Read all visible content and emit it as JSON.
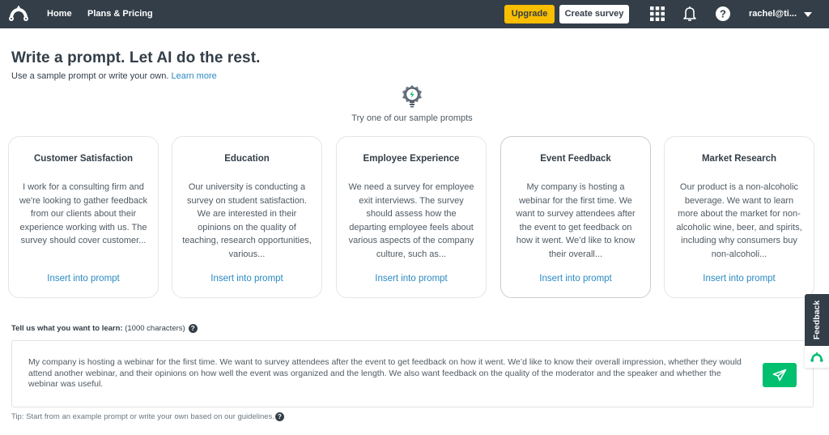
{
  "topbar": {
    "logo_icon": "surveymonkey-logo-icon",
    "nav": [
      {
        "label": "Home"
      },
      {
        "label": "Plans & Pricing"
      }
    ],
    "upgrade_label": "Upgrade",
    "create_survey_label": "Create survey",
    "apps_icon": "apps-grid-icon",
    "notifications_icon": "bell-icon",
    "help_icon": "help-icon",
    "user_label": "rachel@ti...",
    "colors": {
      "bar": "#333e48",
      "upgrade": "#f9be00"
    }
  },
  "header": {
    "title": "Write a prompt. Let AI do the rest.",
    "subtitle": "Use a sample prompt or write your own.",
    "learn_more": "Learn more"
  },
  "samples": {
    "icon": "lightbulb-icon",
    "heading": "Try one of our sample prompts",
    "cards": [
      {
        "title": "Customer Satisfaction",
        "body": "I work for a consulting firm and we're looking to gather feedback from our clients about their experience working with us. The survey should cover customer...",
        "link": "Insert into prompt",
        "selected": false
      },
      {
        "title": "Education",
        "body": "Our university is conducting a survey on student satisfaction. We are interested in their opinions on the quality of teaching, research opportunities, various...",
        "link": "Insert into prompt",
        "selected": false
      },
      {
        "title": "Employee Experience",
        "body": "We need a survey for employee exit interviews. The survey should assess how the departing employee feels about various aspects of the company culture, such as...",
        "link": "Insert into prompt",
        "selected": false
      },
      {
        "title": "Event Feedback",
        "body": "My company is hosting a webinar for the first time. We want to survey attendees after the event to get feedback on how it went. We’d like to know their overall...",
        "link": "Insert into prompt",
        "selected": true
      },
      {
        "title": "Market Research",
        "body": "Our product is a non-alcoholic beverage. We want to learn more about the market for non-alcoholic wine, beer, and spirits, including why consumers buy non-alcoholi...",
        "link": "Insert into prompt",
        "selected": false
      }
    ]
  },
  "prompt": {
    "label": "Tell us what you want to learn:",
    "limit": "(1000 characters)",
    "value": "My company is hosting a webinar for the first time. We want to survey attendees after the event to get feedback on how it went. We’d like to know their overall impression, whether they would attend another webinar, and their opinions on how well the event was organized and the length. We also want feedback on the quality of the moderator and the speaker and whether the webinar was useful.",
    "send_icon": "paper-plane-icon",
    "send_color": "#00bf6f",
    "tip": "Tip: Start from an example prompt or write your own based on our guidelines."
  },
  "feedback_tab": {
    "label": "Feedback"
  }
}
